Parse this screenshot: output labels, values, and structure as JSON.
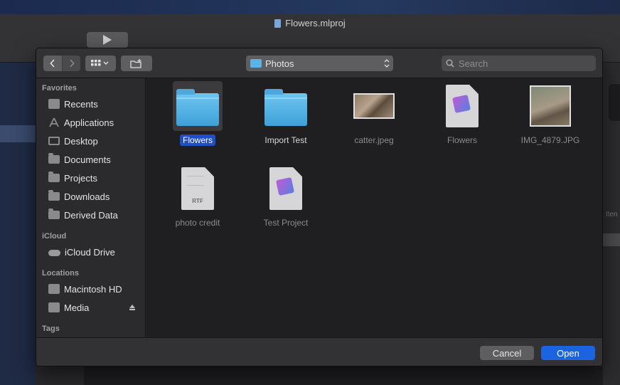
{
  "background": {
    "window_title": "Flowers.mlproj",
    "side_text": "Iten"
  },
  "toolbar": {
    "back_icon": "chevron-left-icon",
    "forward_icon": "chevron-right-icon",
    "view_mode_icon": "icon-grid-view",
    "new_folder_icon": "new-folder-icon",
    "location": "Photos",
    "search_placeholder": "Search"
  },
  "sidebar": {
    "sections": [
      {
        "title": "Favorites",
        "items": [
          {
            "label": "Recents",
            "icon": "recents-icon"
          },
          {
            "label": "Applications",
            "icon": "applications-icon"
          },
          {
            "label": "Desktop",
            "icon": "desktop-icon"
          },
          {
            "label": "Documents",
            "icon": "documents-icon"
          },
          {
            "label": "Projects",
            "icon": "folder-icon"
          },
          {
            "label": "Downloads",
            "icon": "folder-icon"
          },
          {
            "label": "Derived Data",
            "icon": "folder-icon"
          }
        ]
      },
      {
        "title": "iCloud",
        "items": [
          {
            "label": "iCloud Drive",
            "icon": "cloud-icon"
          }
        ]
      },
      {
        "title": "Locations",
        "items": [
          {
            "label": "Macintosh HD",
            "icon": "drive-icon"
          },
          {
            "label": "Media",
            "icon": "drive-icon",
            "ejectable": true
          }
        ]
      },
      {
        "title": "Tags",
        "items": []
      }
    ]
  },
  "files": [
    {
      "name": "Flowers",
      "type": "folder",
      "selected": true,
      "enabled": true
    },
    {
      "name": "Import Test",
      "type": "folder",
      "selected": false,
      "enabled": true
    },
    {
      "name": "catter.jpeg",
      "type": "image",
      "selected": false,
      "enabled": false
    },
    {
      "name": "Flowers",
      "type": "mlproj",
      "selected": false,
      "enabled": false
    },
    {
      "name": "IMG_4879.JPG",
      "type": "image",
      "selected": false,
      "enabled": false
    },
    {
      "name": "photo credit",
      "type": "rtf",
      "badge": "RTF",
      "selected": false,
      "enabled": false
    },
    {
      "name": "Test Project",
      "type": "mlproj",
      "selected": false,
      "enabled": false
    }
  ],
  "footer": {
    "cancel_label": "Cancel",
    "open_label": "Open"
  },
  "colors": {
    "accent": "#1b63e0",
    "selection": "#1f4fc4",
    "folder": "#5ab4e8"
  }
}
